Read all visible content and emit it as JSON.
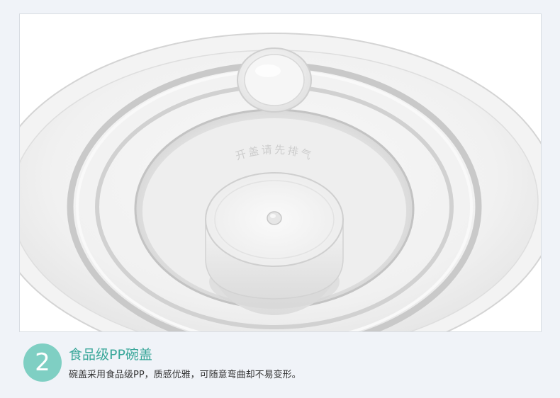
{
  "feature": {
    "step": "2",
    "title": "食品级PP碗盖",
    "description": "碗盖采用食品级PP，质感优雅，可随意弯曲却不易变形。"
  },
  "product_image": {
    "embossed_text": "开盖请先排气"
  },
  "colors": {
    "accent": "#7fcfc3",
    "title": "#3aa79a",
    "page_background": "#f0f3f8"
  }
}
